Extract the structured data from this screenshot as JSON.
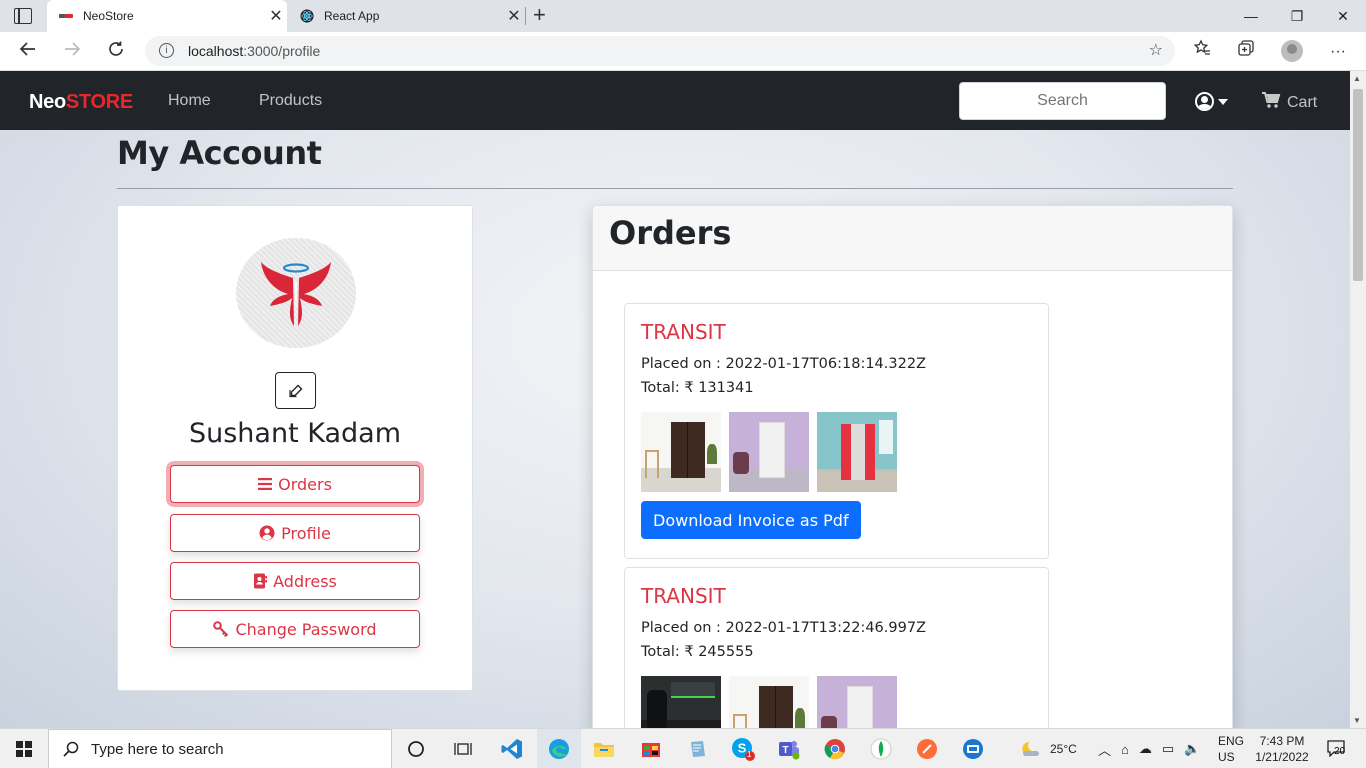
{
  "browser": {
    "tabs": [
      {
        "title": "NeoStore",
        "active": true
      },
      {
        "title": "React App",
        "active": false
      }
    ],
    "url": {
      "host": "localhost",
      "path": ":3000/profile"
    }
  },
  "navbar": {
    "brand_a": "Neo",
    "brand_b": "STORE",
    "links": [
      "Home",
      "Products"
    ],
    "search_placeholder": "Search",
    "cart_label": "Cart"
  },
  "page": {
    "title": "My Account"
  },
  "profile": {
    "name": "Sushant Kadam",
    "menu": [
      {
        "label": "Orders",
        "icon": "list-icon"
      },
      {
        "label": "Profile",
        "icon": "user-circle-icon"
      },
      {
        "label": "Address",
        "icon": "address-card-icon"
      },
      {
        "label": "Change Password",
        "icon": "key-icon"
      }
    ]
  },
  "orders": {
    "heading": "Orders",
    "items": [
      {
        "status": "TRANSIT",
        "placed_label": "Placed on : ",
        "placed_on": "2022-01-17T06:18:14.322Z",
        "total_label": "Total: ₹ ",
        "total": "131341",
        "download_label": "Download Invoice as Pdf"
      },
      {
        "status": "TRANSIT",
        "placed_label": "Placed on : ",
        "placed_on": "2022-01-17T13:22:46.997Z",
        "total_label": "Total: ₹ ",
        "total": "245555"
      }
    ]
  },
  "taskbar": {
    "search_placeholder": "Type here to search",
    "weather": "25°C",
    "lang_top": "ENG",
    "lang_bottom": "US",
    "time": "7:43 PM",
    "date": "1/21/2022",
    "notification_count": "20",
    "skype_badge": "1"
  },
  "colors": {
    "brand_red": "#e8262d",
    "danger": "#dc3545",
    "primary": "#0d6efd",
    "navbar_bg": "#212529"
  }
}
